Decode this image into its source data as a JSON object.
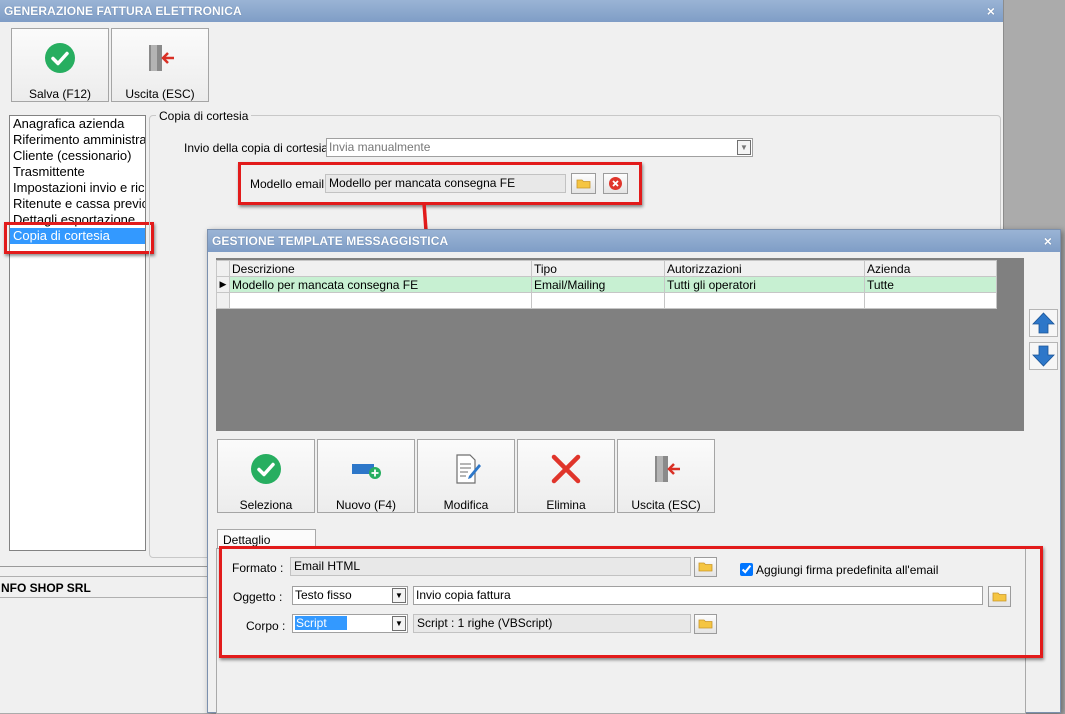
{
  "main_window": {
    "title": "GENERAZIONE FATTURA ELETTRONICA",
    "close": "×",
    "toolbar": {
      "save_label": "Salva (F12)",
      "exit_label": "Uscita (ESC)"
    },
    "nav_items": [
      "Anagrafica azienda",
      "Riferimento amministra",
      "Cliente (cessionario)",
      "Trasmittente",
      "Impostazioni invio e ric",
      "Ritenute e cassa previc",
      "Dettagli esportazione",
      "Copia di cortesia"
    ],
    "selected_nav": "Copia di cortesia",
    "group_title": "Copia di cortesia",
    "send_copy_label": "Invio della copia di cortesia :",
    "send_copy_value": "Invia manualmente",
    "email_model_label": "Modello email :",
    "email_model_value": "Modello per mancata consegna FE",
    "company": "NFO SHOP SRL"
  },
  "dialog": {
    "title": "GESTIONE TEMPLATE MESSAGGISTICA",
    "close": "×",
    "grid": {
      "columns": [
        "Descrizione",
        "Tipo",
        "Autorizzazioni",
        "Azienda"
      ],
      "rows": [
        [
          "Modello per mancata consegna FE",
          "Email/Mailing",
          "Tutti gli operatori",
          "Tutte"
        ]
      ]
    },
    "toolbar": {
      "select": "Seleziona",
      "new": "Nuovo (F4)",
      "edit": "Modifica",
      "delete": "Elimina",
      "exit": "Uscita (ESC)"
    },
    "tab_label": "Dettaglio modello",
    "detail": {
      "format_label": "Formato :",
      "format_value": "Email HTML",
      "signature_label": "Aggiungi firma predefinita all'email",
      "signature_checked": true,
      "subject_label": "Oggetto :",
      "subject_type": "Testo fisso",
      "subject_value": "Invio copia fattura",
      "body_label": "Corpo :",
      "body_type": "Script",
      "body_value": "Script : 1 righe (VBScript)"
    }
  },
  "colors": {
    "highlight_red": "#e21b1b",
    "selection_blue": "#3399ff",
    "row_green": "#c7f0d2",
    "title_blue": "#8aa7cd"
  }
}
